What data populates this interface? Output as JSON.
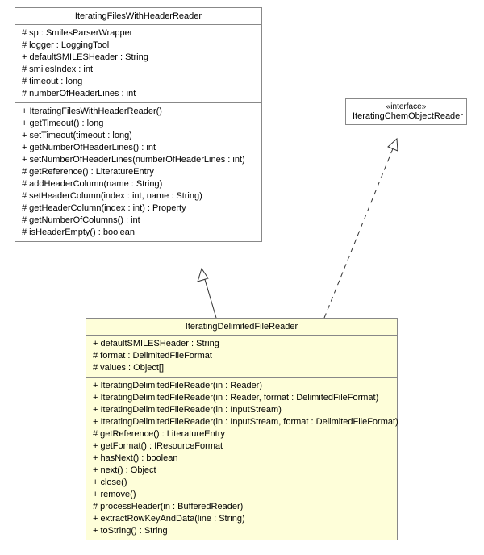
{
  "classes": {
    "parent": {
      "name": "IteratingFilesWithHeaderReader",
      "attributes": [
        "# sp : SmilesParserWrapper",
        "# logger : LoggingTool",
        "+ defaultSMILESHeader : String",
        "# smilesIndex : int",
        "# timeout : long",
        "# numberOfHeaderLines : int"
      ],
      "operations": [
        "+ IteratingFilesWithHeaderReader()",
        "+ getTimeout() : long",
        "+ setTimeout(timeout : long)",
        "+ getNumberOfHeaderLines() : int",
        "+ setNumberOfHeaderLines(numberOfHeaderLines : int)",
        "# getReference() : LiteratureEntry",
        "# addHeaderColumn(name : String)",
        "# setHeaderColumn(index : int, name : String)",
        "# getHeaderColumn(index : int) : Property",
        "# getNumberOfColumns() : int",
        "# isHeaderEmpty() : boolean"
      ]
    },
    "iface": {
      "stereotype": "«interface»",
      "name": "IteratingChemObjectReader"
    },
    "child": {
      "name": "IteratingDelimitedFileReader",
      "attributes": [
        "+ defaultSMILESHeader : String",
        "# format : DelimitedFileFormat",
        "# values : Object[]"
      ],
      "operations": [
        "+ IteratingDelimitedFileReader(in : Reader)",
        "+ IteratingDelimitedFileReader(in : Reader, format : DelimitedFileFormat)",
        "+ IteratingDelimitedFileReader(in : InputStream)",
        "+ IteratingDelimitedFileReader(in : InputStream, format : DelimitedFileFormat)",
        "# getReference() : LiteratureEntry",
        "+ getFormat() : IResourceFormat",
        "+ hasNext() : boolean",
        "+ next() : Object",
        "+ close()",
        "+ remove()",
        "# processHeader(in : BufferedReader)",
        "+ extractRowKeyAndData(line : String)",
        "+ toString() : String"
      ]
    }
  }
}
